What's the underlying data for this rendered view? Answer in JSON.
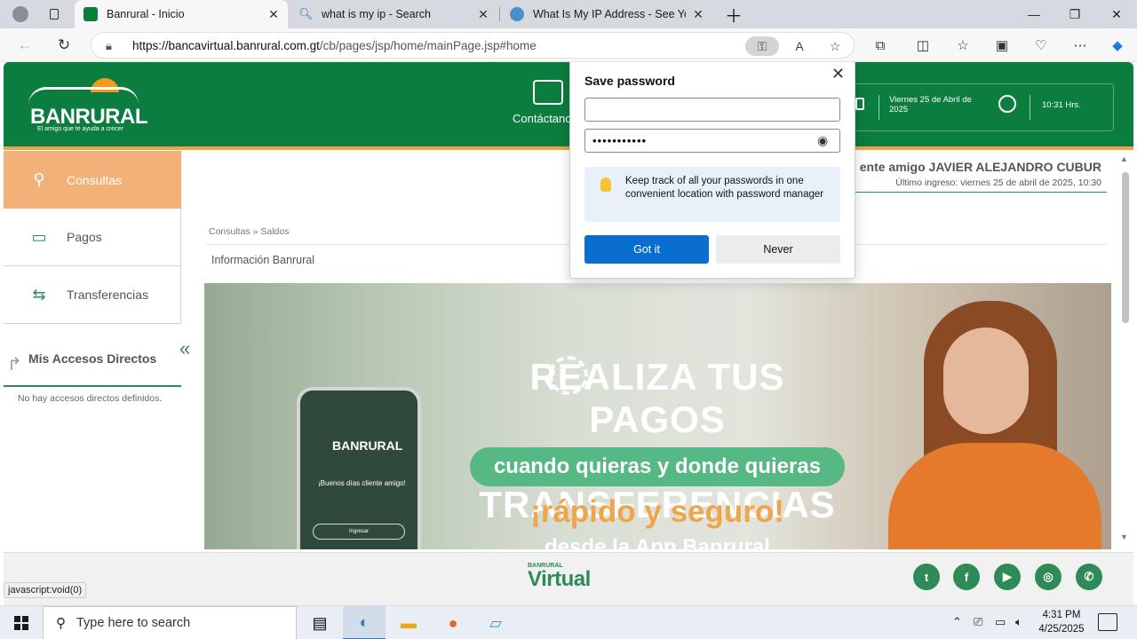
{
  "browser": {
    "tabs": [
      {
        "title": "Banrural - Inicio",
        "favicon": "banrural-favicon",
        "active": true
      },
      {
        "title": "what is my ip - Search",
        "favicon": "search-icon",
        "active": false
      },
      {
        "title": "What Is My IP Address - See Your",
        "favicon": "globe-icon",
        "active": false
      }
    ],
    "url_host": "https://bancavirtual.banrural.com.gt",
    "url_path": "/cb/pages/jsp/home/mainPage.jsp#home"
  },
  "header": {
    "logo_name": "BANRURAL",
    "logo_tagline": "El amigo que te ayuda a crecer",
    "contact_label": "Contáctano",
    "date_label": "Viernes 25 de Abril de 2025",
    "time_label": "10:31 Hrs."
  },
  "sidebar": {
    "items": [
      {
        "label": "Consultas",
        "icon": "search-icon",
        "active": true
      },
      {
        "label": "Pagos",
        "icon": "cash-icon",
        "active": false
      },
      {
        "label": "Transferencias",
        "icon": "transfer-icon",
        "active": false
      }
    ],
    "accesos_title": "Mis Accesos Directos",
    "accesos_empty": "No hay accesos directos definidos."
  },
  "main": {
    "greeting": "ente amigo JAVIER ALEJANDRO CUBUR",
    "last_login": "Último ingreso: viernes 25 de abril de 2025, 10:30",
    "breadcrumb": "Consultas » Saldos",
    "section_title": "Información Banrural",
    "banner": {
      "headline_1": "REALIZA TUS PAGOS",
      "headline_2": "Y TRANSFERENCIAS",
      "pill": "cuando quieras y donde quieras",
      "rapido": "¡rápido y seguro!",
      "desde": "desde la App Banrural",
      "phone_brand": "BANRURAL",
      "phone_welcome": "¡Buenos días cliente amigo!",
      "phone_button": "Ingresar"
    }
  },
  "footer": {
    "brand_small": "BANRURAL",
    "brand": "Virtual",
    "social": [
      "twitter-icon",
      "facebook-icon",
      "youtube-icon",
      "instagram-icon",
      "whatsapp-icon"
    ]
  },
  "status_bar": "javascript:void(0)",
  "save_password": {
    "title": "Save password",
    "username": "",
    "password_mask": "•••••••••••",
    "tip": "Keep track of all your passwords in one convenient location with password manager",
    "got_it": "Got it",
    "never": "Never"
  },
  "taskbar": {
    "search_placeholder": "Type here to search",
    "time": "4:31 PM",
    "date": "4/25/2025"
  }
}
